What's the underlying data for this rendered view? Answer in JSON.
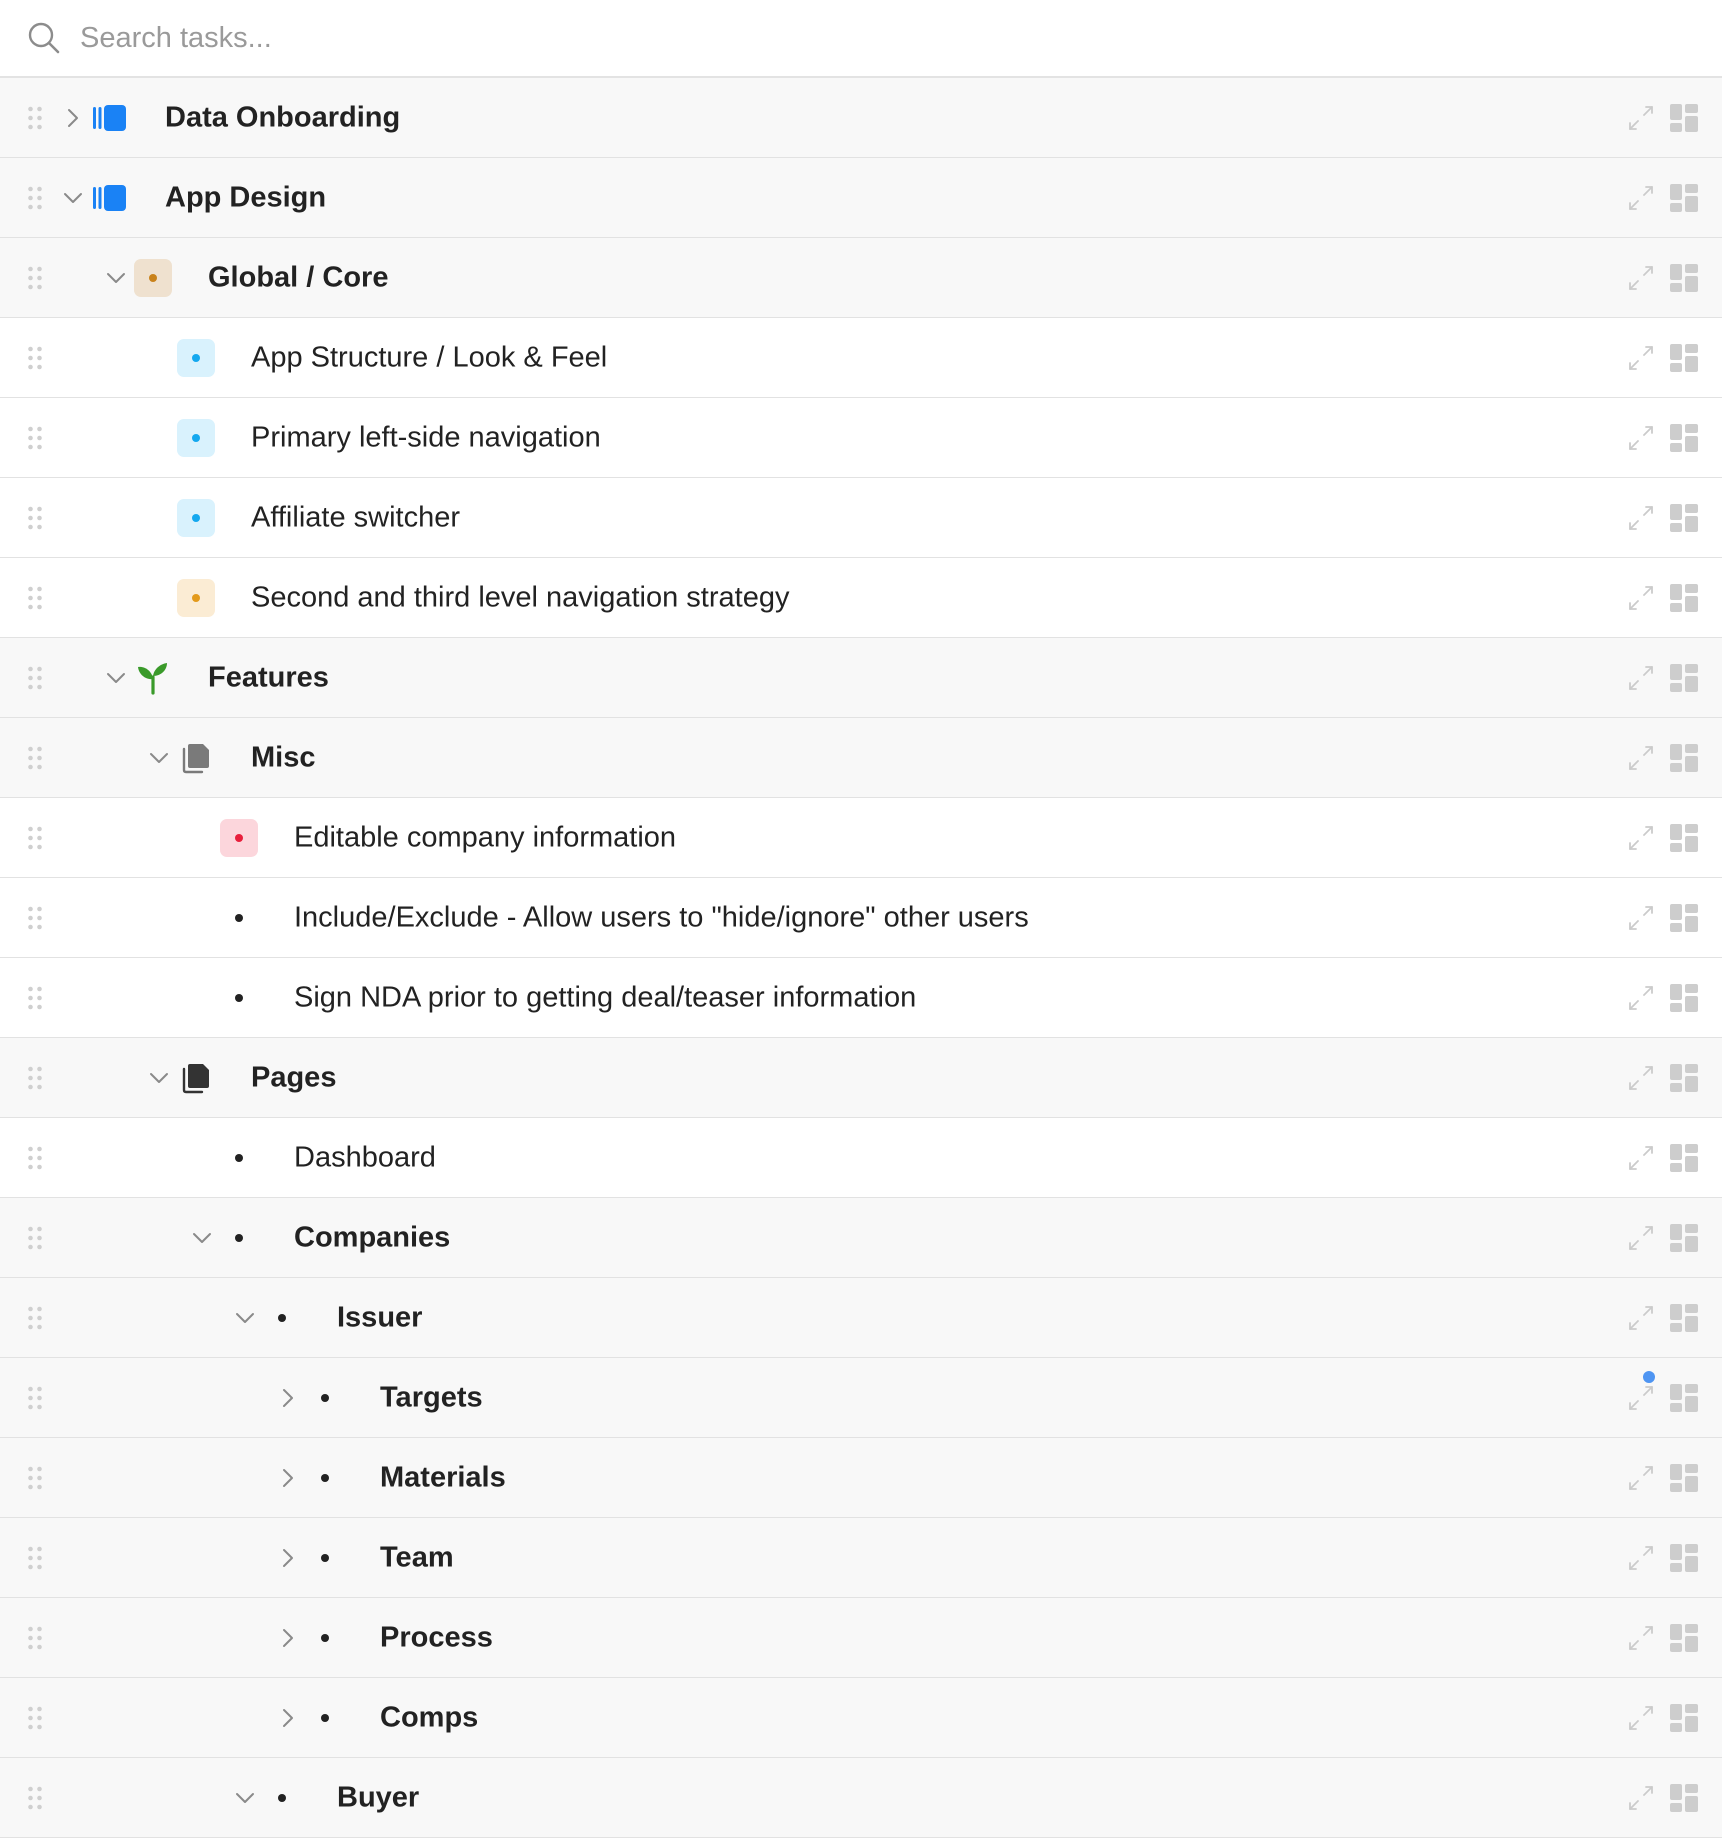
{
  "search": {
    "placeholder": "Search tasks...",
    "value": ""
  },
  "colors": {
    "blue_accent": "#1a82f5",
    "cyan_badge_bg": "#d9f2fd",
    "cyan_badge_dot": "#14a8ef",
    "tan_badge_bg": "#efe1cf",
    "tan_badge_dot": "#c9821b",
    "yellow_badge_bg": "#fbecd4",
    "yellow_badge_dot": "#e39a1b",
    "pink_badge_bg": "#fcd6dc",
    "pink_badge_dot": "#e81f3c",
    "sprout_green": "#3a9a2a",
    "notification_dot": "#4f95f2"
  },
  "rows": [
    {
      "label": "Data Onboarding",
      "level": 0,
      "chevron": "right",
      "icon": "board-blue",
      "group": true
    },
    {
      "label": "App Design",
      "level": 0,
      "chevron": "down",
      "icon": "board-blue",
      "group": true
    },
    {
      "label": "Global / Core",
      "level": 1,
      "chevron": "down",
      "icon": "badge-tan",
      "group": true
    },
    {
      "label": "App Structure / Look & Feel",
      "level": 2,
      "chevron": "none",
      "icon": "badge-cyan",
      "group": false
    },
    {
      "label": "Primary left-side navigation",
      "level": 2,
      "chevron": "none",
      "icon": "badge-cyan",
      "group": false
    },
    {
      "label": "Affiliate switcher",
      "level": 2,
      "chevron": "none",
      "icon": "badge-cyan",
      "group": false
    },
    {
      "label": "Second and third level navigation strategy",
      "level": 2,
      "chevron": "none",
      "icon": "badge-yellow",
      "group": false
    },
    {
      "label": "Features",
      "level": 1,
      "chevron": "down",
      "icon": "sprout",
      "group": true
    },
    {
      "label": "Misc",
      "level": 2,
      "chevron": "down",
      "icon": "pages-gray",
      "group": true
    },
    {
      "label": "Editable company information",
      "level": 3,
      "chevron": "none",
      "icon": "badge-pink",
      "group": false
    },
    {
      "label": "Include/Exclude - Allow users to \"hide/ignore\" other users",
      "level": 3,
      "chevron": "none",
      "icon": "bullet",
      "group": false
    },
    {
      "label": "Sign NDA prior to getting deal/teaser information",
      "level": 3,
      "chevron": "none",
      "icon": "bullet",
      "group": false
    },
    {
      "label": "Pages",
      "level": 2,
      "chevron": "down",
      "icon": "pages-dark",
      "group": true
    },
    {
      "label": "Dashboard",
      "level": 3,
      "chevron": "none",
      "icon": "bullet",
      "group": false
    },
    {
      "label": "Companies",
      "level": 3,
      "chevron": "down",
      "icon": "bullet",
      "group": true
    },
    {
      "label": "Issuer",
      "level": 4,
      "chevron": "down",
      "icon": "bullet",
      "group": true
    },
    {
      "label": "Targets",
      "level": 5,
      "chevron": "right",
      "icon": "bullet",
      "group": true,
      "notification": true
    },
    {
      "label": "Materials",
      "level": 5,
      "chevron": "right",
      "icon": "bullet",
      "group": true
    },
    {
      "label": "Team",
      "level": 5,
      "chevron": "right",
      "icon": "bullet",
      "group": true
    },
    {
      "label": "Process",
      "level": 5,
      "chevron": "right",
      "icon": "bullet",
      "group": true
    },
    {
      "label": "Comps",
      "level": 5,
      "chevron": "right",
      "icon": "bullet",
      "group": true
    },
    {
      "label": "Buyer",
      "level": 4,
      "chevron": "down",
      "icon": "bullet",
      "group": true
    }
  ]
}
